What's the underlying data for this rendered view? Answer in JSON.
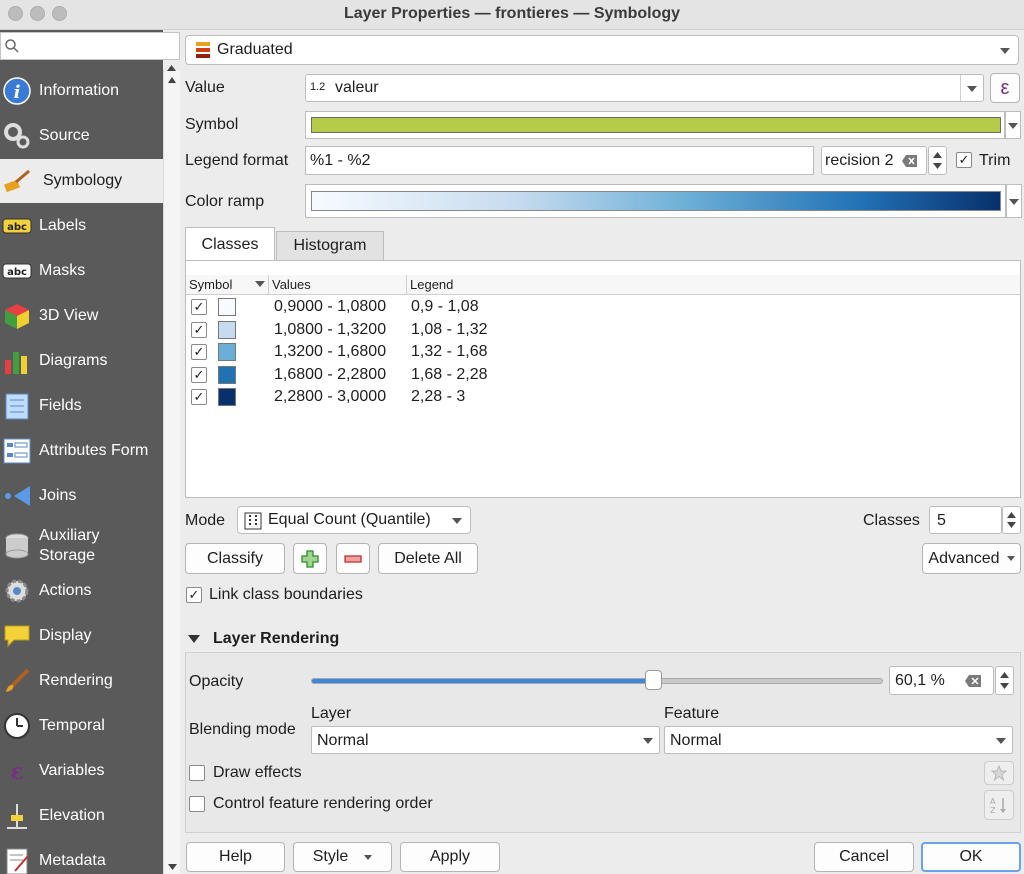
{
  "window": {
    "title": "Layer Properties — frontieres — Symbology"
  },
  "sidebar": {
    "search_placeholder": "",
    "items": [
      {
        "label": "Information",
        "icon": "info-icon"
      },
      {
        "label": "Source",
        "icon": "source-icon"
      },
      {
        "label": "Symbology",
        "icon": "symbology-icon"
      },
      {
        "label": "Labels",
        "icon": "labels-icon"
      },
      {
        "label": "Masks",
        "icon": "masks-icon"
      },
      {
        "label": "3D View",
        "icon": "cube-icon"
      },
      {
        "label": "Diagrams",
        "icon": "diagrams-icon"
      },
      {
        "label": "Fields",
        "icon": "fields-icon"
      },
      {
        "label": "Attributes Form",
        "icon": "form-icon"
      },
      {
        "label": "Joins",
        "icon": "joins-icon"
      },
      {
        "label": "Auxiliary\nStorage",
        "icon": "database-icon"
      },
      {
        "label": "Actions",
        "icon": "actions-icon"
      },
      {
        "label": "Display",
        "icon": "display-icon"
      },
      {
        "label": "Rendering",
        "icon": "brush-icon"
      },
      {
        "label": "Temporal",
        "icon": "clock-icon"
      },
      {
        "label": "Variables",
        "icon": "epsilon-icon"
      },
      {
        "label": "Elevation",
        "icon": "elevation-icon"
      },
      {
        "label": "Metadata",
        "icon": "metadata-icon"
      }
    ]
  },
  "renderer": {
    "selected": "Graduated"
  },
  "value": {
    "label": "Value",
    "type_badge": "1.2",
    "field": "valeur",
    "expr_button": "ε"
  },
  "symbol": {
    "label": "Symbol",
    "color": "#b5cc4a"
  },
  "legend_format": {
    "label": "Legend format",
    "value": "%1 - %2",
    "precision_text": "recision 2",
    "trim_label": "Trim"
  },
  "color_ramp": {
    "label": "Color ramp",
    "start": "#f7fbff",
    "end": "#08306b"
  },
  "tabs": {
    "classes": "Classes",
    "histogram": "Histogram"
  },
  "table": {
    "headers": {
      "symbol": "Symbol",
      "values": "Values",
      "legend": "Legend"
    },
    "rows": [
      {
        "values": "0,9000 - 1,0800",
        "legend": "0,9 - 1,08",
        "color": "#f7fbff"
      },
      {
        "values": "1,0800 - 1,3200",
        "legend": "1,08 - 1,32",
        "color": "#c6dbef"
      },
      {
        "values": "1,3200 - 1,6800",
        "legend": "1,32 - 1,68",
        "color": "#6baed6"
      },
      {
        "values": "1,6800 - 2,2800",
        "legend": "1,68 - 2,28",
        "color": "#2171b5"
      },
      {
        "values": "2,2800 - 3,0000",
        "legend": "2,28 - 3",
        "color": "#08306b"
      }
    ]
  },
  "mode": {
    "label": "Mode",
    "value": "Equal Count (Quantile)",
    "classes_label": "Classes",
    "classes_value": "5"
  },
  "actions": {
    "classify": "Classify",
    "delete_all": "Delete All",
    "advanced": "Advanced"
  },
  "link_boundaries": {
    "label": "Link class boundaries",
    "checked": true
  },
  "layer_rendering": {
    "title": "Layer Rendering",
    "opacity_label": "Opacity",
    "opacity_value": "60,1 %",
    "opacity_fraction": 0.601,
    "blending_label": "Blending mode",
    "layer_label": "Layer",
    "feature_label": "Feature",
    "layer_mode": "Normal",
    "feature_mode": "Normal",
    "draw_effects": "Draw effects",
    "control_order": "Control feature rendering order"
  },
  "footer": {
    "help": "Help",
    "style": "Style",
    "apply": "Apply",
    "cancel": "Cancel",
    "ok": "OK"
  }
}
